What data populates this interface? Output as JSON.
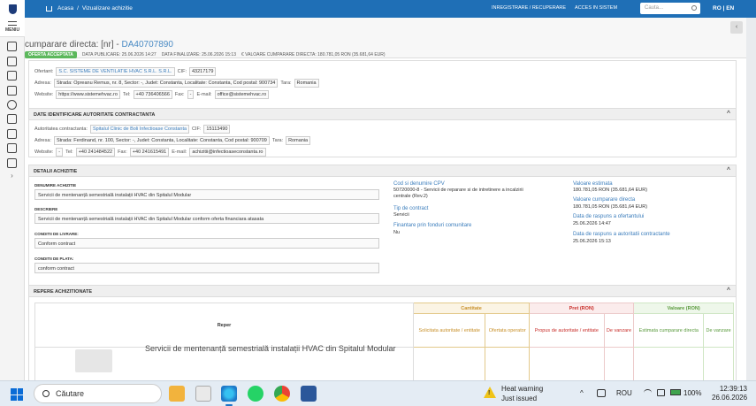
{
  "topbar": {
    "breadcrumb_home": "Acasa",
    "breadcrumb_sep": "/",
    "breadcrumb_current": "Vizualizare achizitie",
    "register_link": "INREGISTRARE / RECUPERARE",
    "access_link": "ACCES IN SISTEM",
    "search_placeholder": "Cauta...",
    "lang_ro": "RO",
    "lang_sep": "|",
    "lang_en": "EN"
  },
  "sidebar": {
    "menu_label": "MENIU",
    "expand_glyph": "›"
  },
  "header": {
    "title_prefix": "cumparare directa: [nr] -",
    "title_code": "DA40707890",
    "status_badge": "OFERTA ACCEPTATA",
    "published": "DATA PUBLICARE: 25.06.2026 14:27",
    "finalized": "DATA FINALIZARE: 25.06.2026 15:13",
    "value": "€ VALOARE CUMPARARE DIRECTA: 180.781,05 RON (35.681,64 EUR)",
    "collapse_glyph": "‹"
  },
  "supplier": {
    "ofertant_label": "Ofertant:",
    "ofertant": "S.C. SISTEME DE VENTILATIE HVAC S.R.L. S.R.L.",
    "cif_label": "CIF:",
    "cif": "43217179",
    "adresa_label": "Adresa:",
    "adresa": "Strada: Opreanu Remus, nr. 8, Sector: -, Judet: Constanta, Localitate: Constanta, Cod postal: 900734",
    "tara_label": "Tara:",
    "tara": "Romania",
    "website_label": "Website:",
    "website": "https://www.sistemehvac.ro",
    "tel_label": "Tel:",
    "tel": "+40 736406566",
    "fax_label": "Fax:",
    "fax": "-",
    "email_label": "E-mail:",
    "email": "office@sistemehvac.ro"
  },
  "authority": {
    "section_title": "DATE IDENTIFICARE AUTORITATE CONTRACTANTA",
    "label": "Autoritatea contractanta:",
    "name": "Spitalul Clinic de Boli Infectioase Constanta",
    "cif_label": "CIF:",
    "cif": "15113490",
    "adresa_label": "Adresa:",
    "adresa": "Strada: Ferdinand, nr. 100, Sector: -, Judet: Constanta, Localitate: Constanta, Cod postal: 900709",
    "tara_label": "Tara:",
    "tara": "Romania",
    "website_label": "Website:",
    "website": "-",
    "tel_label": "Tel:",
    "tel": "+40 241484522",
    "fax_label": "Fax:",
    "fax": "+40 241615491",
    "email_label": "E-mail:",
    "email": "achizitii@infectioaseconstanta.ro"
  },
  "details": {
    "section_title": "DETALII ACHIZITIE",
    "denumire_label": "DENUMIRE ACHIZITIE",
    "denumire": "Servicii de mentenanță semestrială instalații HVAC din Spitalul Modular",
    "descriere_label": "DESCRIERE",
    "descriere": "Servicii de mentenanță semestrială instalații HVAC din Spitalul Modular conform oferta financiara atasata",
    "livrare_label": "CONDITII DE LIVRARE:",
    "livrare": "Conform contract",
    "plata_label": "CONDITII DE PLATA:",
    "plata": "conform contract",
    "cpv_label": "Cod si denumire CPV",
    "cpv_line1": "50720000-8 - Servicii de reparare si de intretinere a incalzirii",
    "cpv_line2": "centrale (Rev.2)",
    "tip_label": "Tip de contract",
    "tip": "Servicii",
    "fonduri_label": "Finantare prin fonduri comunitare",
    "fonduri": "Nu",
    "estimata_label": "Valoare estimata",
    "estimata": "180.781,05 RON (35.681,64 EUR)",
    "cumparare_label": "Valoare cumparare directa",
    "cumparare": "180.781,05 RON (35.681,64 EUR)",
    "raspuns_label": "Data de raspuns a ofertantului",
    "raspuns": "25.06.2026 14:47",
    "autoritate_label": "Data de raspuns a autoritatii contractante",
    "autoritate": "25.06.2026 15:13"
  },
  "items": {
    "section_title": "REPERE ACHIZITIONATE",
    "col_reper": "Reper",
    "group_cantitate": "Cantitate",
    "group_pret": "Pret (RON)",
    "group_valoare": "Valoare (RON)",
    "sub_solicitata": "Solicitata autoritate / entitate",
    "sub_oferta": "Ofertata operator",
    "sub_propus": "Propus de autoritate / entitate",
    "sub_vanzare": "De vanzare",
    "sub_estimata": "Estimata cumparare directa",
    "sub_val_vanzare": "De vanzare",
    "row_name": "Servicii de mentenanță semestrială instalații HVAC din Spitalul Modular"
  },
  "taskbar": {
    "search_placeholder": "Căutare",
    "warn_title": "Heat warning",
    "warn_sub": "Just issued",
    "lang": "ROU",
    "battery": "100%",
    "time": "12:39:13",
    "date": "26.06.2026",
    "chevron": "^"
  }
}
